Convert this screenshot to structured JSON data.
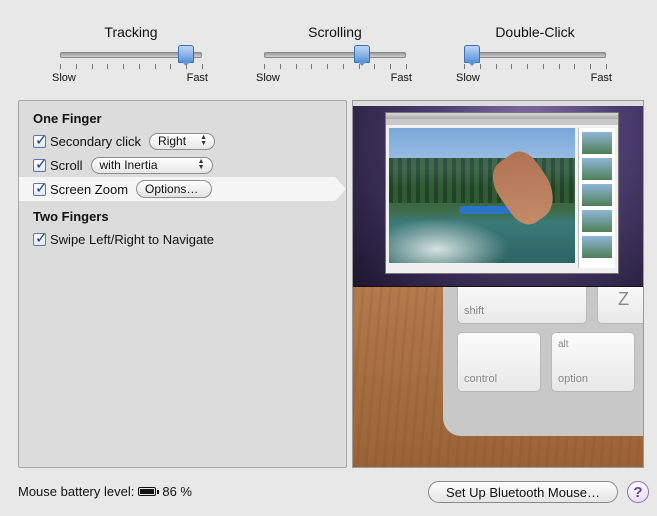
{
  "sliders": [
    {
      "title": "Tracking",
      "min_label": "Slow",
      "max_label": "Fast",
      "value": 0.92,
      "ticks": 10
    },
    {
      "title": "Scrolling",
      "min_label": "Slow",
      "max_label": "Fast",
      "value": 0.7,
      "ticks": 10
    },
    {
      "title": "Double-Click",
      "min_label": "Slow",
      "max_label": "Fast",
      "value": 0.0,
      "ticks": 10
    }
  ],
  "one_finger": {
    "title": "One Finger",
    "secondary_click": {
      "label": "Secondary click",
      "checked": true,
      "value": "Right"
    },
    "scroll": {
      "label": "Scroll",
      "checked": true,
      "value": "with Inertia"
    },
    "screen_zoom": {
      "label": "Screen Zoom",
      "checked": true,
      "options_label": "Options…"
    }
  },
  "two_fingers": {
    "title": "Two Fingers",
    "swipe": {
      "label": "Swipe Left/Right to Navigate",
      "checked": true
    }
  },
  "preview": {
    "keys": {
      "z": "Z",
      "shift": "shift",
      "alt": "alt",
      "option": "option",
      "control": "control"
    }
  },
  "battery": {
    "label": "Mouse battery level:",
    "percent": "86 %",
    "level": 0.86
  },
  "setup_button": "Set Up Bluetooth Mouse…",
  "help": "?"
}
